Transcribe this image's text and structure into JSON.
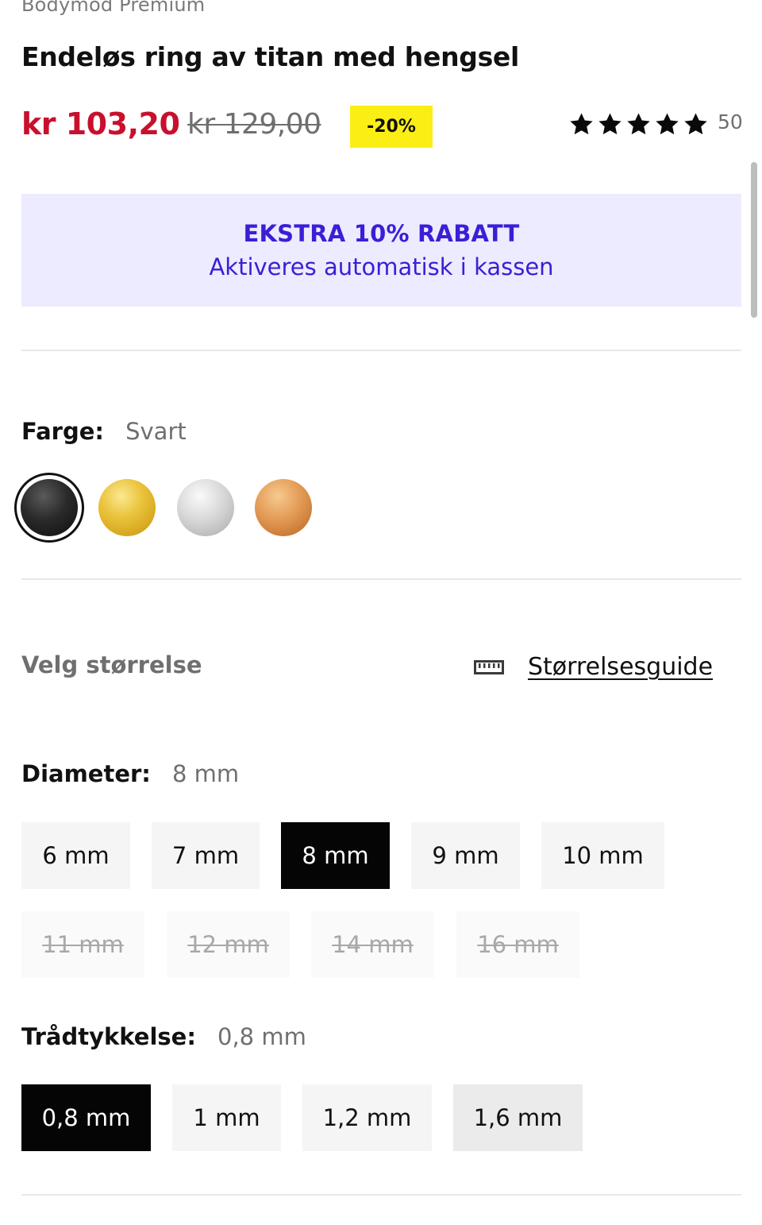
{
  "product": {
    "brand": "Bodymod Premium",
    "title": "Endeløs ring av titan med hengsel",
    "price": "kr 103,20",
    "old_price": "kr 129,00",
    "discount": "-20%",
    "rating": {
      "stars": 5,
      "max": 5,
      "count": "50"
    }
  },
  "promo": {
    "title": "EKSTRA 10% RABATT",
    "subtitle": "Aktiveres automatisk i kassen"
  },
  "color": {
    "label": "Farge:",
    "selected": "Svart",
    "swatches": [
      {
        "name": "Svart",
        "icon": "swatch-black",
        "color": "#1a1a1a"
      },
      {
        "name": "Gull",
        "icon": "swatch-gold",
        "color": "#e8bf3a"
      },
      {
        "name": "Sølv",
        "icon": "swatch-silver",
        "color": "#cfcfcf"
      },
      {
        "name": "Rosegull",
        "icon": "swatch-rose-gold",
        "color": "#de8f48"
      }
    ]
  },
  "size": {
    "label": "Velg størrelse",
    "guide_label": "Størrelsesguide",
    "guide_icon": "ruler-icon"
  },
  "diameter": {
    "label": "Diameter:",
    "selected": "8 mm",
    "options": [
      {
        "label": "6 mm",
        "state": "normal"
      },
      {
        "label": "7 mm",
        "state": "normal"
      },
      {
        "label": "8 mm",
        "state": "active"
      },
      {
        "label": "9 mm",
        "state": "normal"
      },
      {
        "label": "10 mm",
        "state": "normal"
      },
      {
        "label": "11 mm",
        "state": "disabled"
      },
      {
        "label": "12 mm",
        "state": "disabled"
      },
      {
        "label": "14 mm",
        "state": "disabled"
      },
      {
        "label": "16 mm",
        "state": "disabled"
      }
    ]
  },
  "thickness": {
    "label": "Trådtykkelse:",
    "selected": "0,8 mm",
    "options": [
      {
        "label": "0,8 mm",
        "state": "active"
      },
      {
        "label": "1 mm",
        "state": "normal"
      },
      {
        "label": "1,2 mm",
        "state": "normal"
      },
      {
        "label": "1,6 mm",
        "state": "hover"
      }
    ]
  },
  "colors": {
    "sale_red": "#c8102e",
    "badge_yellow": "#fbee14",
    "promo_bg": "#ecebff",
    "promo_text": "#3b1ed6"
  }
}
